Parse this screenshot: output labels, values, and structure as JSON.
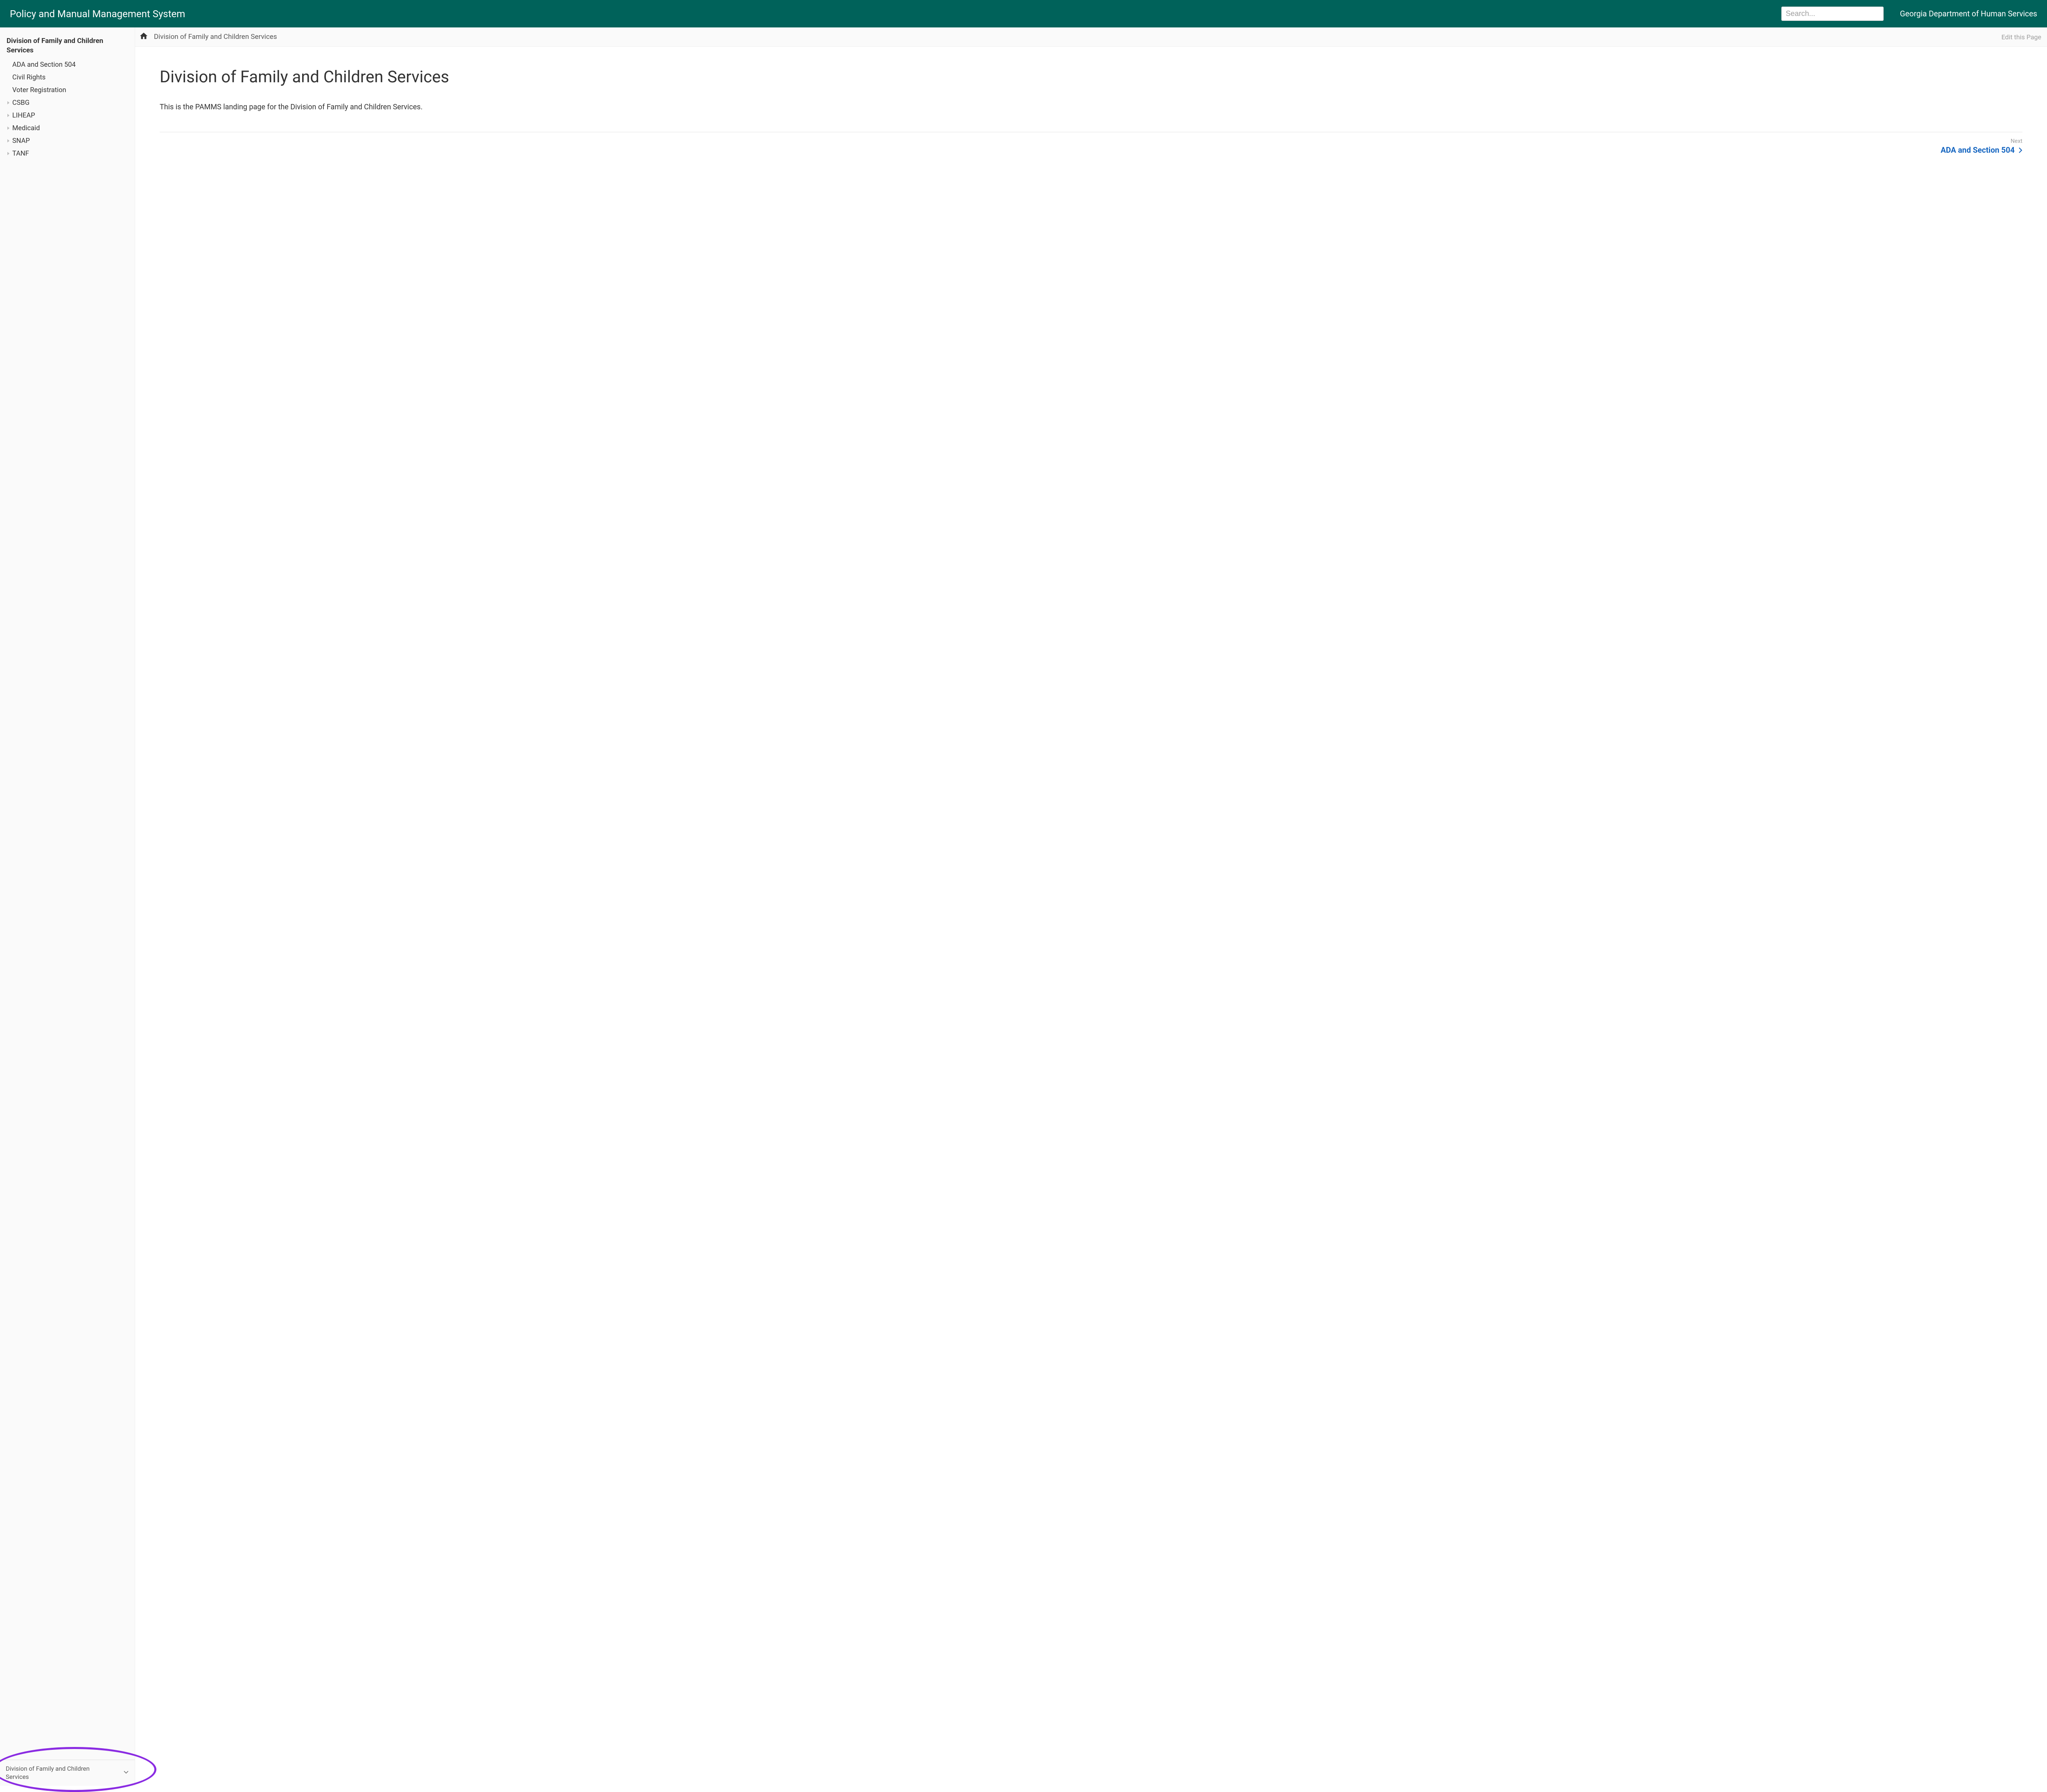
{
  "header": {
    "title": "Policy and Manual Management System",
    "search_placeholder": "Search...",
    "department": "Georgia Department of Human Services"
  },
  "sidebar": {
    "title": "Division of Family and Children Services",
    "items": [
      {
        "label": "ADA and Section 504",
        "expandable": false
      },
      {
        "label": "Civil Rights",
        "expandable": false
      },
      {
        "label": "Voter Registration",
        "expandable": false
      },
      {
        "label": "CSBG",
        "expandable": true
      },
      {
        "label": "LIHEAP",
        "expandable": true
      },
      {
        "label": "Medicaid",
        "expandable": true
      },
      {
        "label": "SNAP",
        "expandable": true
      },
      {
        "label": "TANF",
        "expandable": true
      }
    ],
    "footer_selector": "Division of Family and Children Services"
  },
  "toolbar": {
    "breadcrumb": "Division of Family and Children Services",
    "edit_label": "Edit this Page"
  },
  "page": {
    "heading": "Division of Family and Children Services",
    "body": "This is the PAMMS landing page for the Division of Family and Children Services."
  },
  "pager": {
    "next_label": "Next",
    "next_title": "ADA and Section 504"
  }
}
